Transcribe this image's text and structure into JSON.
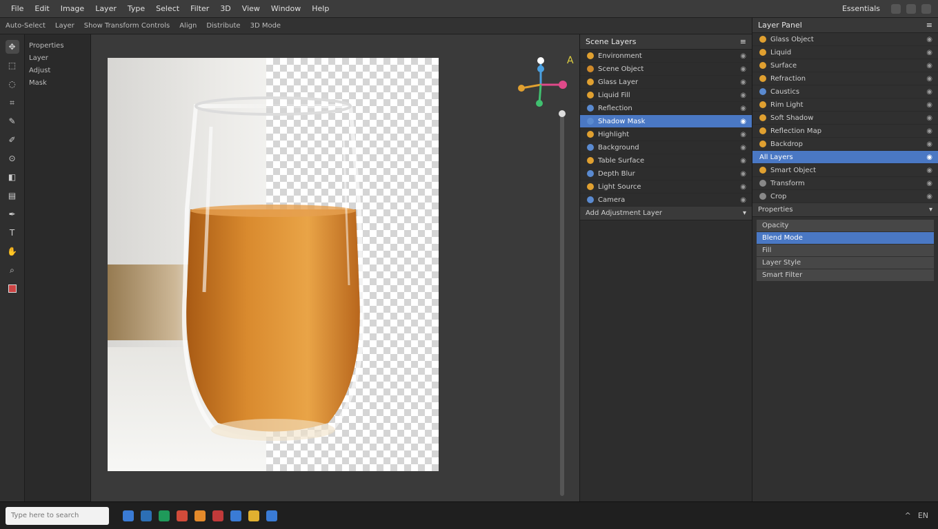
{
  "menubar": {
    "items": [
      "File",
      "Edit",
      "Image",
      "Layer",
      "Type",
      "Select",
      "Filter",
      "3D",
      "View",
      "Window",
      "Help"
    ],
    "workspace_label": "Essentials"
  },
  "optionsbar": {
    "items": [
      "Auto-Select",
      "Layer",
      "Show Transform Controls",
      "Align",
      "Distribute",
      "3D Mode"
    ]
  },
  "tools": {
    "icons": [
      "move-tool-icon",
      "marquee-tool-icon",
      "lasso-tool-icon",
      "crop-tool-icon",
      "eyedropper-tool-icon",
      "brush-tool-icon",
      "stamp-tool-icon",
      "eraser-tool-icon",
      "gradient-tool-icon",
      "pen-tool-icon",
      "type-tool-icon",
      "hand-tool-icon",
      "zoom-tool-icon",
      "foreground-color-icon"
    ]
  },
  "leftpanel": {
    "items": [
      "Properties",
      "Layer",
      "Adjust",
      "Mask"
    ]
  },
  "panel_a": {
    "header": "Scene Layers",
    "rows": [
      {
        "label": "Environment",
        "color": "#e0a030"
      },
      {
        "label": "Scene Object",
        "color": "#d08a2a"
      },
      {
        "label": "Glass Layer",
        "color": "#e0a030"
      },
      {
        "label": "Liquid Fill",
        "color": "#e0a030"
      },
      {
        "label": "Reflection",
        "color": "#5a8ad0"
      },
      {
        "label": "Shadow Mask",
        "color": "#5a8ad0",
        "selected": true
      },
      {
        "label": "Highlight",
        "color": "#e0a030"
      },
      {
        "label": "Background",
        "color": "#5a8ad0"
      },
      {
        "label": "Table Surface",
        "color": "#e0a030"
      },
      {
        "label": "Depth Blur",
        "color": "#5a8ad0"
      },
      {
        "label": "Light Source",
        "color": "#e0a030"
      },
      {
        "label": "Camera",
        "color": "#5a8ad0"
      }
    ],
    "footer": "Add Adjustment Layer"
  },
  "panel_b": {
    "header": "Layer Panel",
    "rows": [
      {
        "label": "Glass Object",
        "color": "#e0a030"
      },
      {
        "label": "Liquid",
        "color": "#e0a030"
      },
      {
        "label": "Surface",
        "color": "#e0a030"
      },
      {
        "label": "Refraction",
        "color": "#e0a030"
      },
      {
        "label": "Caustics",
        "color": "#5a8ad0"
      },
      {
        "label": "Rim Light",
        "color": "#e0a030"
      },
      {
        "label": "Soft Shadow",
        "color": "#e0a030"
      },
      {
        "label": "Reflection Map",
        "color": "#e0a030"
      },
      {
        "label": "Backdrop",
        "color": "#e0a030"
      }
    ],
    "group_selected": "All Layers",
    "group_rows": [
      {
        "label": "Smart Object",
        "color": "#e0a030"
      },
      {
        "label": "Transform",
        "color": "#888888"
      },
      {
        "label": "Crop",
        "color": "#888888"
      }
    ],
    "props_header": "Properties",
    "props": [
      {
        "label": "Opacity",
        "selected": false
      },
      {
        "label": "Blend Mode",
        "selected": true
      },
      {
        "label": "Fill",
        "selected": false
      },
      {
        "label": "Layer Style",
        "selected": false
      },
      {
        "label": "Smart Filter",
        "selected": false
      }
    ]
  },
  "statusbar": {
    "search_placeholder": "Type here to search",
    "task_icon_colors": [
      "#3a7bd5",
      "#2c6fb5",
      "#1f9a5a",
      "#d24b3a",
      "#e48a2a",
      "#c23a3a",
      "#3a7bd5",
      "#e0b030",
      "#3a7bd5"
    ],
    "tray": [
      "^",
      "EN"
    ]
  },
  "colors": {
    "accent": "#4a78c4",
    "liquid": "#c77320",
    "background": "#262626"
  }
}
